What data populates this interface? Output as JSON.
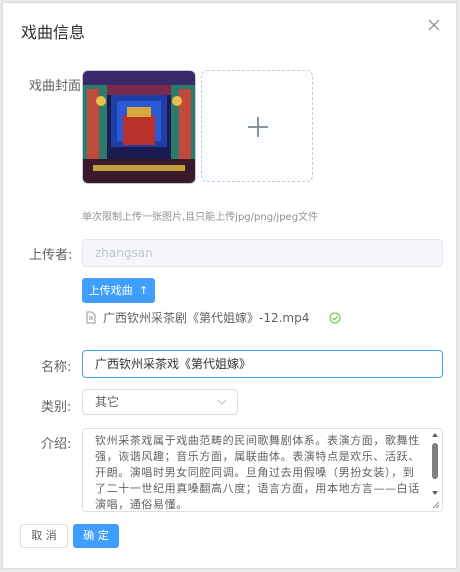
{
  "dialog": {
    "title": "戏曲信息"
  },
  "cover": {
    "label": "戏曲封面",
    "tip": "单次限制上传一张图片,且只能上传jpg/png/jpeg文件"
  },
  "uploader": {
    "label": "上传者:",
    "value": "zhangsan"
  },
  "video": {
    "button_label": "上传戏曲",
    "file_name": "广西钦州采茶剧《第代姐嫁》-12.mp4"
  },
  "name": {
    "label": "名称:",
    "value": "广西钦州采茶戏《第代姐嫁》"
  },
  "category": {
    "label": "类别:",
    "value": "其它"
  },
  "intro": {
    "label": "介绍:",
    "value": "钦州采茶戏属于戏曲范畴的民间歌舞剧体系。表演方面，歌舞性强，诙谐风趣；音乐方面，属联曲体。表演特点是欢乐、活跃、开朗。演唱时男女同腔同调。旦角过去用假嗓（男扮女装），到了二十一世纪用真嗓翻高八度；语言方面，用本地方言——白话演唱，通俗易懂。"
  },
  "footer": {
    "cancel_label": "取 消",
    "confirm_label": "确 定"
  },
  "colors": {
    "primary": "#409eff",
    "success": "#67c23a"
  }
}
